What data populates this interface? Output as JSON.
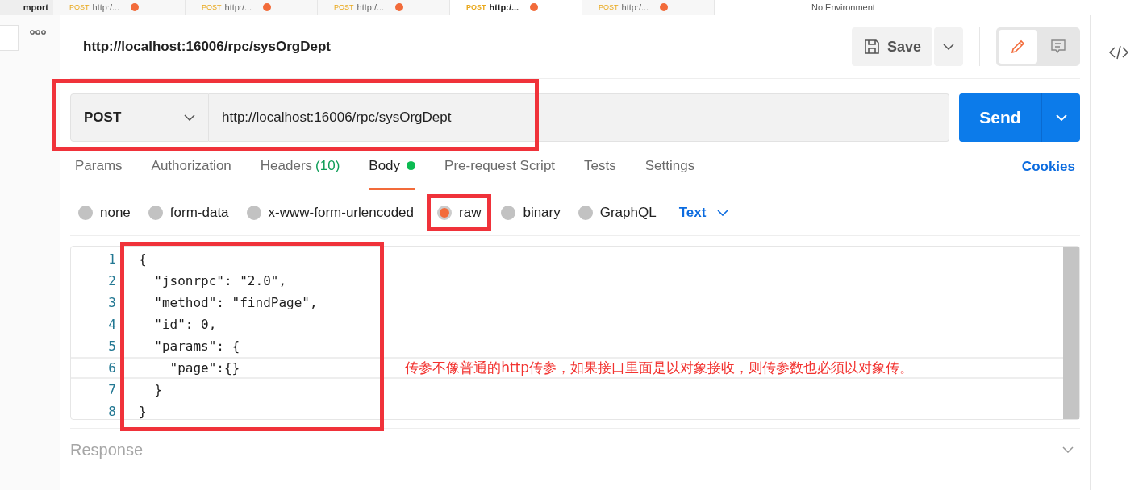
{
  "top_bar": {
    "import_label": "mport",
    "tabs": [
      {
        "method": "POST",
        "url": "http:/...",
        "selected": false
      },
      {
        "method": "POST",
        "url": "http:/...",
        "selected": false
      },
      {
        "method": "POST",
        "url": "http:/...",
        "selected": false
      },
      {
        "method": "POST",
        "url": "http:/...",
        "selected": true
      },
      {
        "method": "POST",
        "url": "http:/...",
        "selected": false
      }
    ],
    "environment": "No Environment"
  },
  "request": {
    "title": "http://localhost:16006/rpc/sysOrgDept",
    "save": "Save",
    "method": "POST",
    "url": "http://localhost:16006/rpc/sysOrgDept",
    "send": "Send"
  },
  "tabs": [
    {
      "label": "Params",
      "selected": false
    },
    {
      "label": "Authorization",
      "selected": false
    },
    {
      "label": "Headers",
      "count": "(10)",
      "selected": false
    },
    {
      "label": "Body",
      "selected": true,
      "dot": true
    },
    {
      "label": "Pre-request Script",
      "selected": false
    },
    {
      "label": "Tests",
      "selected": false
    },
    {
      "label": "Settings",
      "selected": false
    }
  ],
  "cookies": "Cookies",
  "body_types": [
    {
      "label": "none",
      "selected": false
    },
    {
      "label": "form-data",
      "selected": false
    },
    {
      "label": "x-www-form-urlencoded",
      "selected": false
    },
    {
      "label": "raw",
      "selected": true
    },
    {
      "label": "binary",
      "selected": false
    },
    {
      "label": "GraphQL",
      "selected": false
    }
  ],
  "format": "Text",
  "editor": {
    "lines": [
      {
        "number": "1",
        "text": "{"
      },
      {
        "number": "2",
        "text": "  \"jsonrpc\": \"2.0\","
      },
      {
        "number": "3",
        "text": "  \"method\": \"findPage\","
      },
      {
        "number": "4",
        "text": "  \"id\": 0,"
      },
      {
        "number": "5",
        "text": "  \"params\": {"
      },
      {
        "number": "6",
        "text": "    \"page\":{}"
      },
      {
        "number": "7",
        "text": "  }"
      },
      {
        "number": "8",
        "text": "}"
      }
    ],
    "annotation": "传参不像普通的http传参，如果接口里面是以对象接收，则传参数也必须以对象传。"
  },
  "response": {
    "label": "Response"
  }
}
